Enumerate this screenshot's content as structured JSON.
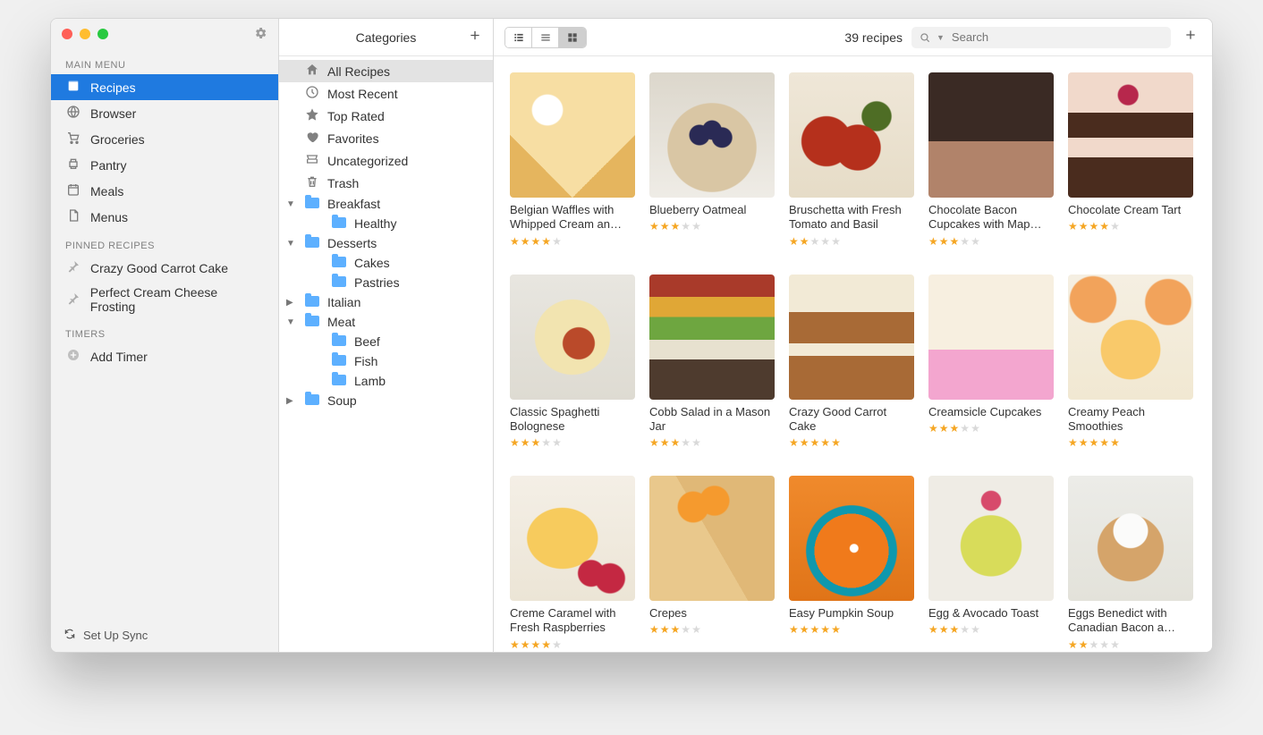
{
  "sidebar": {
    "sections": {
      "main_menu": {
        "header": "MAIN MENU",
        "items": [
          {
            "id": "recipes",
            "label": "Recipes",
            "icon": "recipe-box-icon",
            "selected": true
          },
          {
            "id": "browser",
            "label": "Browser",
            "icon": "globe-icon",
            "selected": false
          },
          {
            "id": "groceries",
            "label": "Groceries",
            "icon": "cart-icon",
            "selected": false
          },
          {
            "id": "pantry",
            "label": "Pantry",
            "icon": "printer-icon",
            "selected": false
          },
          {
            "id": "meals",
            "label": "Meals",
            "icon": "calendar-icon",
            "selected": false
          },
          {
            "id": "menus",
            "label": "Menus",
            "icon": "document-icon",
            "selected": false
          }
        ]
      },
      "pinned": {
        "header": "PINNED RECIPES",
        "items": [
          {
            "id": "p1",
            "label": "Crazy Good Carrot Cake",
            "icon": "pin-icon"
          },
          {
            "id": "p2",
            "label": "Perfect Cream Cheese Frosting",
            "icon": "pin-icon"
          }
        ]
      },
      "timers": {
        "header": "TIMERS",
        "add_label": "Add Timer"
      }
    },
    "footer": {
      "label": "Set Up Sync"
    }
  },
  "categories": {
    "header": "Categories",
    "items": [
      {
        "id": "all",
        "label": "All Recipes",
        "icon": "home-icon",
        "depth": 0,
        "selected": true
      },
      {
        "id": "recent",
        "label": "Most Recent",
        "icon": "clock-icon",
        "depth": 0
      },
      {
        "id": "top",
        "label": "Top Rated",
        "icon": "star-icon",
        "depth": 0
      },
      {
        "id": "fav",
        "label": "Favorites",
        "icon": "heart-icon",
        "depth": 0
      },
      {
        "id": "uncat",
        "label": "Uncategorized",
        "icon": "inbox-icon",
        "depth": 0
      },
      {
        "id": "trash",
        "label": "Trash",
        "icon": "trash-icon",
        "depth": 0
      },
      {
        "id": "breakfast",
        "label": "Breakfast",
        "icon": "folder-icon",
        "depth": 0,
        "expanded": true
      },
      {
        "id": "healthy",
        "label": "Healthy",
        "icon": "folder-icon",
        "depth": 1
      },
      {
        "id": "desserts",
        "label": "Desserts",
        "icon": "folder-icon",
        "depth": 0,
        "expanded": true
      },
      {
        "id": "cakes",
        "label": "Cakes",
        "icon": "folder-icon",
        "depth": 1
      },
      {
        "id": "pastries",
        "label": "Pastries",
        "icon": "folder-icon",
        "depth": 1
      },
      {
        "id": "italian",
        "label": "Italian",
        "icon": "folder-icon",
        "depth": 0
      },
      {
        "id": "meat",
        "label": "Meat",
        "icon": "folder-icon",
        "depth": 0,
        "expanded": true
      },
      {
        "id": "beef",
        "label": "Beef",
        "icon": "folder-icon",
        "depth": 1
      },
      {
        "id": "fish",
        "label": "Fish",
        "icon": "folder-icon",
        "depth": 1
      },
      {
        "id": "lamb",
        "label": "Lamb",
        "icon": "folder-icon",
        "depth": 1
      },
      {
        "id": "soup",
        "label": "Soup",
        "icon": "folder-icon",
        "depth": 0
      }
    ]
  },
  "main": {
    "recipe_count_label": "39 recipes",
    "search_placeholder": "Search",
    "active_view": "grid",
    "recipes": [
      {
        "title": "Belgian Waffles with Whipped Cream an…",
        "rating": 4,
        "thumb": "tb-waffle"
      },
      {
        "title": "Blueberry Oatmeal",
        "rating": 3,
        "thumb": "tb-oatmeal"
      },
      {
        "title": "Bruschetta with Fresh Tomato and Basil",
        "rating": 2,
        "thumb": "tb-bruschetta"
      },
      {
        "title": "Chocolate Bacon Cupcakes with Map…",
        "rating": 3,
        "thumb": "tb-cupcake-choc"
      },
      {
        "title": "Chocolate Cream Tart",
        "rating": 4,
        "thumb": "tb-creamtart"
      },
      {
        "title": "Classic Spaghetti Bolognese",
        "rating": 3,
        "thumb": "tb-spaghetti"
      },
      {
        "title": "Cobb Salad in a Mason Jar",
        "rating": 3,
        "thumb": "tb-cobb"
      },
      {
        "title": "Crazy Good Carrot Cake",
        "rating": 5,
        "thumb": "tb-carrot"
      },
      {
        "title": "Creamsicle Cupcakes",
        "rating": 3,
        "thumb": "tb-cream-cup"
      },
      {
        "title": "Creamy Peach Smoothies",
        "rating": 5,
        "thumb": "tb-smoothie"
      },
      {
        "title": "Creme Caramel with Fresh Raspberries",
        "rating": 4,
        "thumb": "tb-caramel"
      },
      {
        "title": "Crepes",
        "rating": 3,
        "thumb": "tb-crepes"
      },
      {
        "title": "Easy Pumpkin Soup",
        "rating": 5,
        "thumb": "tb-pumpkin"
      },
      {
        "title": "Egg & Avocado Toast",
        "rating": 3,
        "thumb": "tb-avocado"
      },
      {
        "title": "Eggs Benedict with Canadian Bacon a…",
        "rating": 2,
        "thumb": "tb-benedict"
      }
    ]
  }
}
